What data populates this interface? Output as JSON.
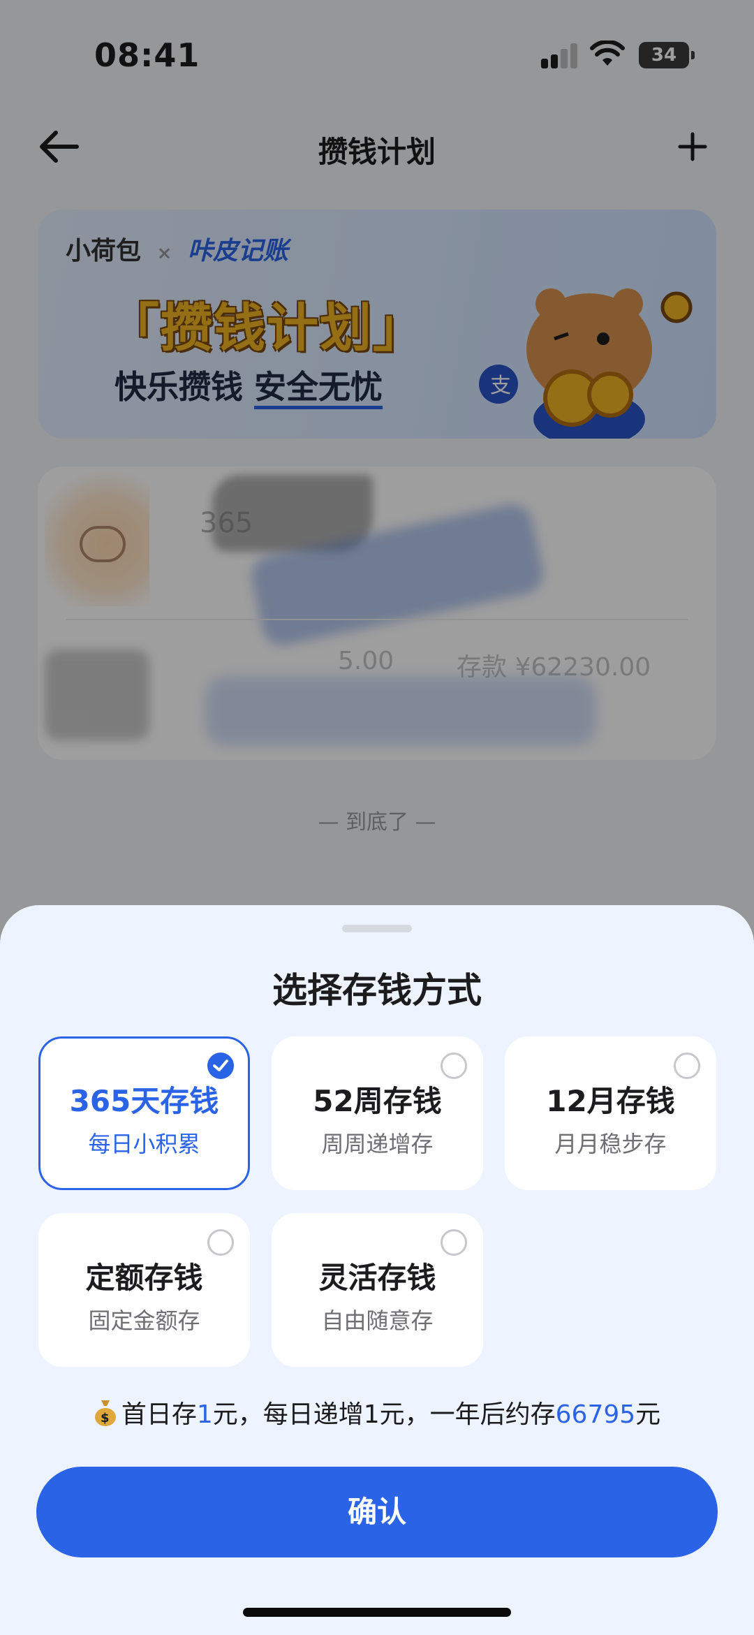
{
  "status_bar": {
    "time": "08:41",
    "battery": "34"
  },
  "header": {
    "title": "攒钱计划"
  },
  "banner": {
    "brand_a": "小荷包",
    "brand_x": "×",
    "brand_b": "咔皮记账",
    "title": "「攒钱计划」",
    "subtitle_plain": "快乐攒钱",
    "subtitle_underlined": "安全无忧"
  },
  "plan_card": {
    "amount_partial": "365",
    "amount_mid": "5.00",
    "saved_label": "存款 ¥62230.00"
  },
  "end_hint": "— 到底了 —",
  "sheet": {
    "title": "选择存钱方式",
    "options": [
      {
        "label": "365天存钱",
        "desc": "每日小积累",
        "selected": true
      },
      {
        "label": "52周存钱",
        "desc": "周周递增存",
        "selected": false
      },
      {
        "label": "12月存钱",
        "desc": "月月稳步存",
        "selected": false
      },
      {
        "label": "定额存钱",
        "desc": "固定金额存",
        "selected": false
      },
      {
        "label": "灵活存钱",
        "desc": "自由随意存",
        "selected": false
      }
    ],
    "summary": {
      "part1": "首日存",
      "first_amount": "1",
      "part2": "元，每日递增1元，一年后约存",
      "total": "66795",
      "part3": "元"
    },
    "confirm_label": "确认"
  },
  "colors": {
    "accent": "#2a63e6",
    "sheet_bg": "#eef4ff"
  }
}
